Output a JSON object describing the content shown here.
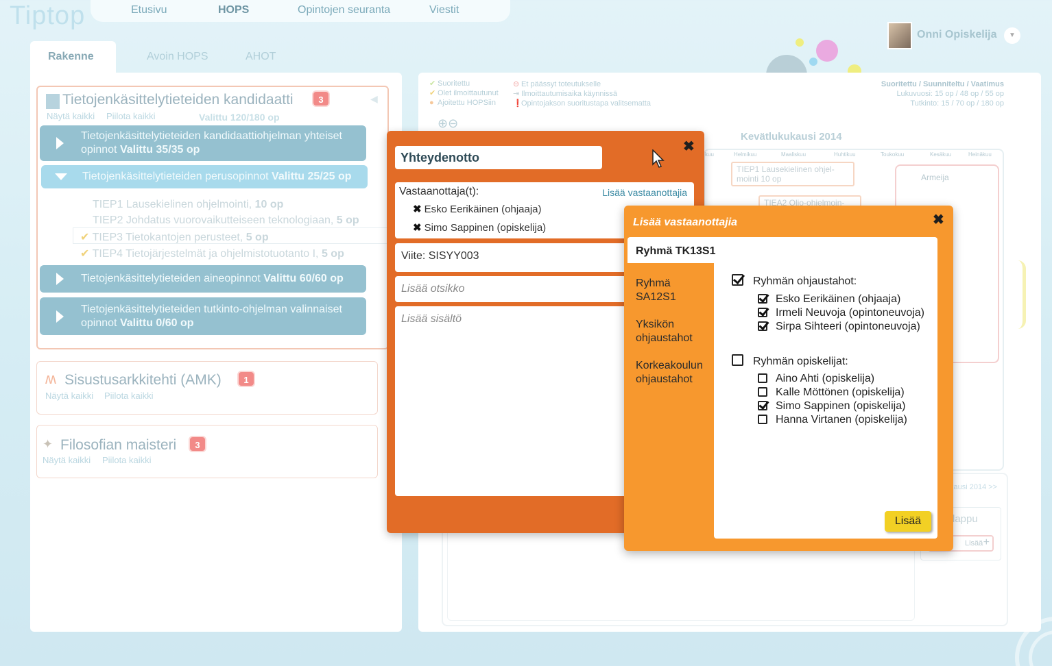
{
  "app": {
    "logo": "Tiptop"
  },
  "topnav": [
    "Etusivu",
    "HOPS",
    "Opintojen seuranta",
    "Viestit"
  ],
  "user": {
    "name": "Onni Opiskelija"
  },
  "tabs": {
    "active": "Rakenne",
    "others": [
      "Avoin HOPS",
      "AHOT"
    ]
  },
  "degrees": [
    {
      "title": "Tietojenkäsittelytieteiden kandidaatti",
      "badge": "3",
      "show_all": "Näytä kaikki",
      "hide_all": "Piilota kaikki",
      "selected": "Valittu 120/180 op"
    },
    {
      "title": "Sisustusarkkitehti (AMK)",
      "badge": "1",
      "show_all": "Näytä kaikki",
      "hide_all": "Piilota kaikki"
    },
    {
      "title": "Filosofian maisteri",
      "badge": "3",
      "show_all": "Näytä kaikki",
      "hide_all": "Piilota kaikki"
    }
  ],
  "modules": [
    {
      "name": "Tietojenkäsittelytieteiden kandidaattiohjelman yhteiset opinnot",
      "selected": "Valittu 35/35 op"
    },
    {
      "name": "Tietojenkäsittelytieteiden perusopinnot",
      "selected": "Valittu 25/25 op"
    },
    {
      "name": "Tietojenkäsittelytieteiden aineopinnot",
      "selected": "Valittu 60/60 op"
    },
    {
      "name": "Tietojenkäsittelytieteiden tutkinto-ohjelman valinnaiset opinnot",
      "selected": "Valittu 0/60 op"
    }
  ],
  "courses": [
    {
      "name": "TIEP1 Lausekielinen ohjelmointi,",
      "credits": "10 op"
    },
    {
      "name": "TIEP2 Johdatus vuorovaikutteiseen teknologiaan,",
      "credits": "5 op"
    },
    {
      "name": "TIEP3 Tietokantojen perusteet,",
      "credits": "5 op"
    },
    {
      "name": "TIEP4 Tietojärjestelmät ja ohjelmistotuotanto I,",
      "credits": "5 op"
    }
  ],
  "calendar": {
    "legend_left": [
      "Suoritettu",
      "Olet ilmoittautunut",
      "Ajoitettu HOPSiin"
    ],
    "legend_mid": [
      "Et päässyt toteutukselle",
      "Ilmoittautumisaika käynnissä",
      "Opintojakson suoritustapa valitsematta"
    ],
    "summary_head": "Suoritettu / Suunniteltu / Vaatimus",
    "summary_year": "Lukuvuosi: 15 op / 48 op / 55 op",
    "summary_degree": "Tutkinto: 15 / 70 op / 180 op",
    "term": "Kevätlukukausi 2014",
    "months": [
      "kuu",
      "Helmikuu",
      "Maaliskuu",
      "Huhtikuu",
      "Toukokuu",
      "Kesäkuu",
      "Heinäkuu"
    ],
    "card1": "TIEP1 Lausekielinen ohjel- mointi 10 op",
    "card2": "TIEA2 Olio-ohjelmoin-",
    "armeija": "Armeija",
    "next": "kausi 2014 >>",
    "lappu_title": "lappu",
    "lappu_add": "Lisää"
  },
  "contact_dialog": {
    "title": "Yhteydenotto",
    "recipients_label": "Vastaanottaja(t):",
    "add_recipients": "Lisää vastaanottajia",
    "recipients": [
      "Esko Eerikäinen (ohjaaja)",
      "Simo Sappinen (opiskelija)"
    ],
    "reference": "Viite: SISYY003",
    "subject_placeholder": "Lisää otsikko",
    "body_placeholder": "Lisää sisältö"
  },
  "add_dialog": {
    "title": "Lisää vastaanottajia",
    "selected_group": "Ryhmä TK13S1",
    "other_tabs": [
      "Ryhmä SA12S1",
      "Yksikön ohjaustahot",
      "Korkeakoulun ohjaustahot"
    ],
    "section1": {
      "label": "Ryhmän ohjaustahot:",
      "checked": true
    },
    "advisors": [
      {
        "name": "Esko Eerikäinen (ohjaaja)",
        "checked": true
      },
      {
        "name": "Irmeli Neuvoja (opintoneuvoja)",
        "checked": true
      },
      {
        "name": "Sirpa Sihteeri (opintoneuvoja)",
        "checked": true
      }
    ],
    "section2": {
      "label": "Ryhmän opiskelijat:",
      "checked": false
    },
    "students": [
      {
        "name": "Aino Ahti (opiskelija)",
        "checked": false
      },
      {
        "name": "Kalle Möttönen (opiskelija)",
        "checked": false
      },
      {
        "name": "Simo Sappinen (opiskelija)",
        "checked": true
      },
      {
        "name": "Hanna Virtanen (opiskelija)",
        "checked": false
      }
    ],
    "add_button": "Lisää"
  }
}
